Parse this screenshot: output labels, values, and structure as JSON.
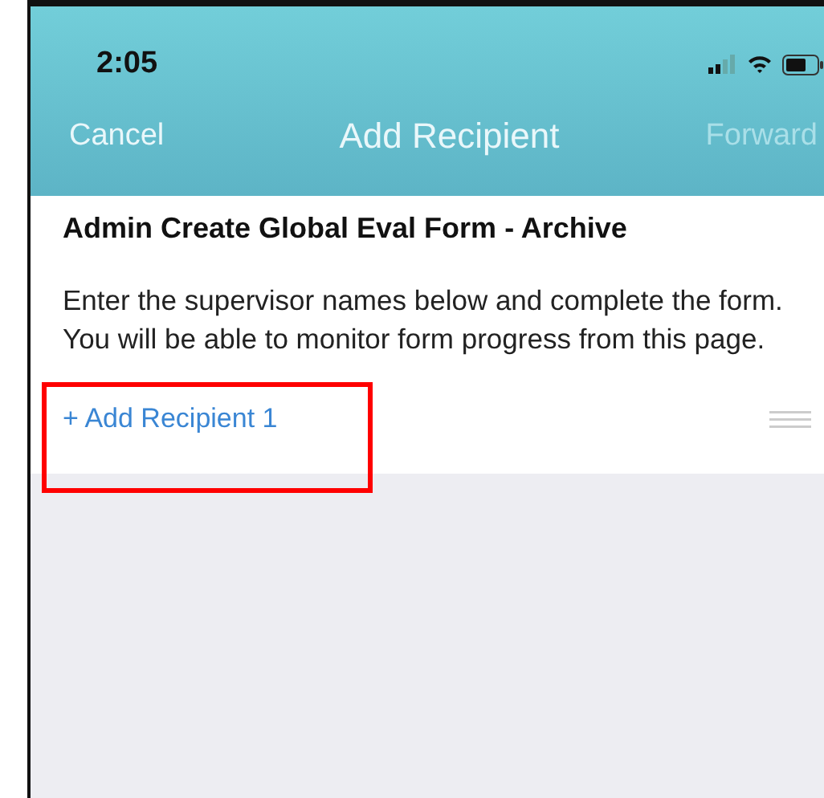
{
  "status_bar": {
    "time": "2:05"
  },
  "nav": {
    "cancel": "Cancel",
    "title": "Add Recipient",
    "forward": {
      "label": "Forward",
      "disabled": true
    }
  },
  "form_title": "Admin Create Global Eval Form - Archive",
  "description": "Enter the supervisor names below and complete the form. You will be able to monitor form progress from this page.",
  "recipients": [
    {
      "label": "+ Add Recipient 1",
      "highlighted": true
    }
  ]
}
